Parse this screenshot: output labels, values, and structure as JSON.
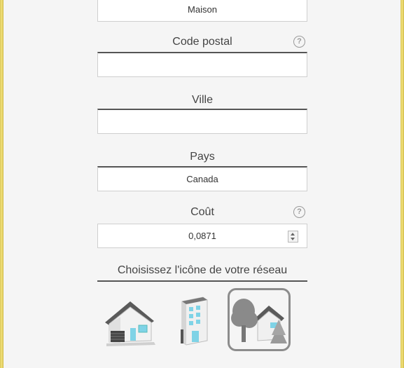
{
  "form": {
    "type_value": "Maison",
    "postal_code": {
      "label": "Code postal",
      "value": "",
      "help": "?"
    },
    "city": {
      "label": "Ville",
      "value": ""
    },
    "country": {
      "label": "Pays",
      "value": "Canada"
    },
    "cost": {
      "label": "Coût",
      "value": "0,0871",
      "help": "?"
    }
  },
  "icon_section": {
    "title": "Choisissez l'icône de votre réseau",
    "icons": [
      {
        "name": "house-garage-icon",
        "selected": false
      },
      {
        "name": "apartment-building-icon",
        "selected": false
      },
      {
        "name": "house-trees-icon",
        "selected": true
      }
    ]
  },
  "colors": {
    "frame": "#e9d76a",
    "selected_border": "#8c8c8c"
  }
}
